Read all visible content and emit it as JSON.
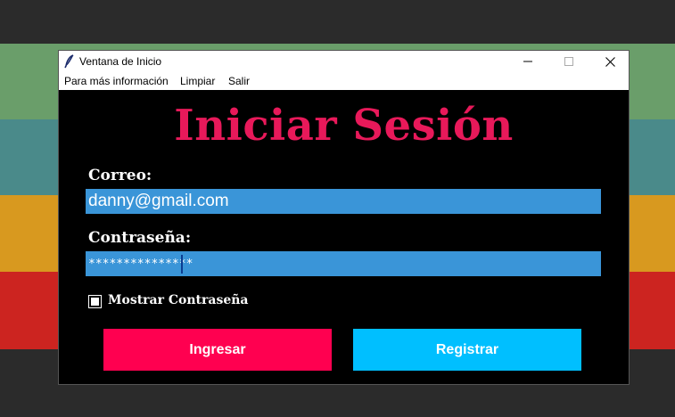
{
  "window": {
    "title": "Ventana de Inicio",
    "icon": "feather-icon"
  },
  "menu": {
    "items": [
      "Para más información",
      "Limpiar",
      "Salir"
    ]
  },
  "form": {
    "heading": "Iniciar Sesión",
    "email_label": "Correo:",
    "email_value": "danny@gmail.com",
    "password_label": "Contraseña:",
    "password_value": "***************",
    "show_password_label": "Mostrar Contraseña",
    "show_password_checked": false
  },
  "buttons": {
    "login": "Ingresar",
    "register": "Registrar"
  },
  "colors": {
    "heading": "#e8195a",
    "entry_bg": "#3a95d8",
    "login_bg": "#ff0050",
    "register_bg": "#00bfff",
    "bg_bands": [
      "#6a9e6a",
      "#4a8a8a",
      "#d8991f",
      "#cc2420"
    ]
  }
}
